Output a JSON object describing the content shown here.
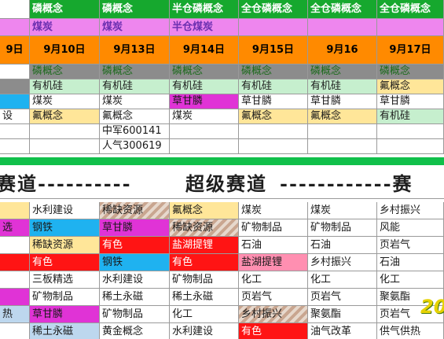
{
  "header_row": [
    "",
    "磷概念",
    "磷概念",
    "半仓磷概念",
    "全仓磷概念",
    "全仓磷概念",
    "全仓磷概念"
  ],
  "sub_row": [
    "",
    "煤炭",
    "煤炭",
    "半仓煤炭",
    "",
    "",
    ""
  ],
  "date_row": [
    "9日",
    "9月10日",
    "9月13日",
    "9月14日",
    "9月15日",
    "9月16",
    "9月17日"
  ],
  "top_rows": [
    [
      "",
      "磷概念",
      "磷概念",
      "磷概念",
      "磷概念",
      "磷概念",
      "磷概念"
    ],
    [
      "",
      "有机硅",
      "有机硅",
      "有机硅",
      "有机硅",
      "有机硅",
      "氟概念"
    ],
    [
      "",
      "煤炭",
      "煤炭",
      "草甘膦",
      "草甘膦",
      "草甘膦",
      "草甘膦"
    ],
    [
      "设",
      "氟概念",
      "氟概念",
      "煤炭",
      "氟概念",
      "氟概念",
      "有机硅"
    ],
    [
      "",
      "",
      "中军600141",
      "",
      "",
      "",
      ""
    ],
    [
      "",
      "",
      "人气300619",
      "",
      "",
      "",
      ""
    ]
  ],
  "band": {
    "left_text": "赛道----------",
    "center_text": "超级赛道",
    "right_text": "------------赛"
  },
  "bottom_rows": [
    [
      "",
      "水利建设",
      "稀缺资源",
      "氟概念",
      "煤炭",
      "煤炭",
      "乡村振兴"
    ],
    [
      "选",
      "钢铁",
      "草甘膦",
      "稀缺资源",
      "矿物制品",
      "矿物制品",
      "风能"
    ],
    [
      "",
      "稀缺资源",
      "有色",
      "盐湖提锂",
      "石油",
      "石油",
      "页岩气"
    ],
    [
      "",
      "有色",
      "钢铁",
      "有色",
      "盐湖提锂",
      "乡村振兴",
      "石油"
    ],
    [
      "",
      "三板精选",
      "水利建设",
      "矿物制品",
      "化工",
      "化工",
      "化工"
    ],
    [
      "",
      "矿物制品",
      "稀土永磁",
      "稀土永磁",
      "页岩气",
      "页岩气",
      "聚氨酯"
    ],
    [
      "热",
      "草甘膦",
      "矿物制品",
      "化工",
      "乡村振兴",
      "聚氨酯",
      "页岩气"
    ],
    [
      "",
      "稀土永磁",
      "黄金概念",
      "水利建设",
      "有色",
      "油气改革",
      "供气供热"
    ]
  ],
  "logo_text": "20",
  "colors": {
    "header_green": "#16a82e",
    "sub_pink": "#ee86ee",
    "date_orange": "#ff8a00",
    "gray_row": "#8c8c8c",
    "light_green": "#c6efce",
    "cyan": "#1fb2f0",
    "magenta": "#e033d6",
    "light_yellow": "#ffe699",
    "red": "#ff1414",
    "pink": "#ff8fb1",
    "light_blue": "#bdd7ee"
  }
}
